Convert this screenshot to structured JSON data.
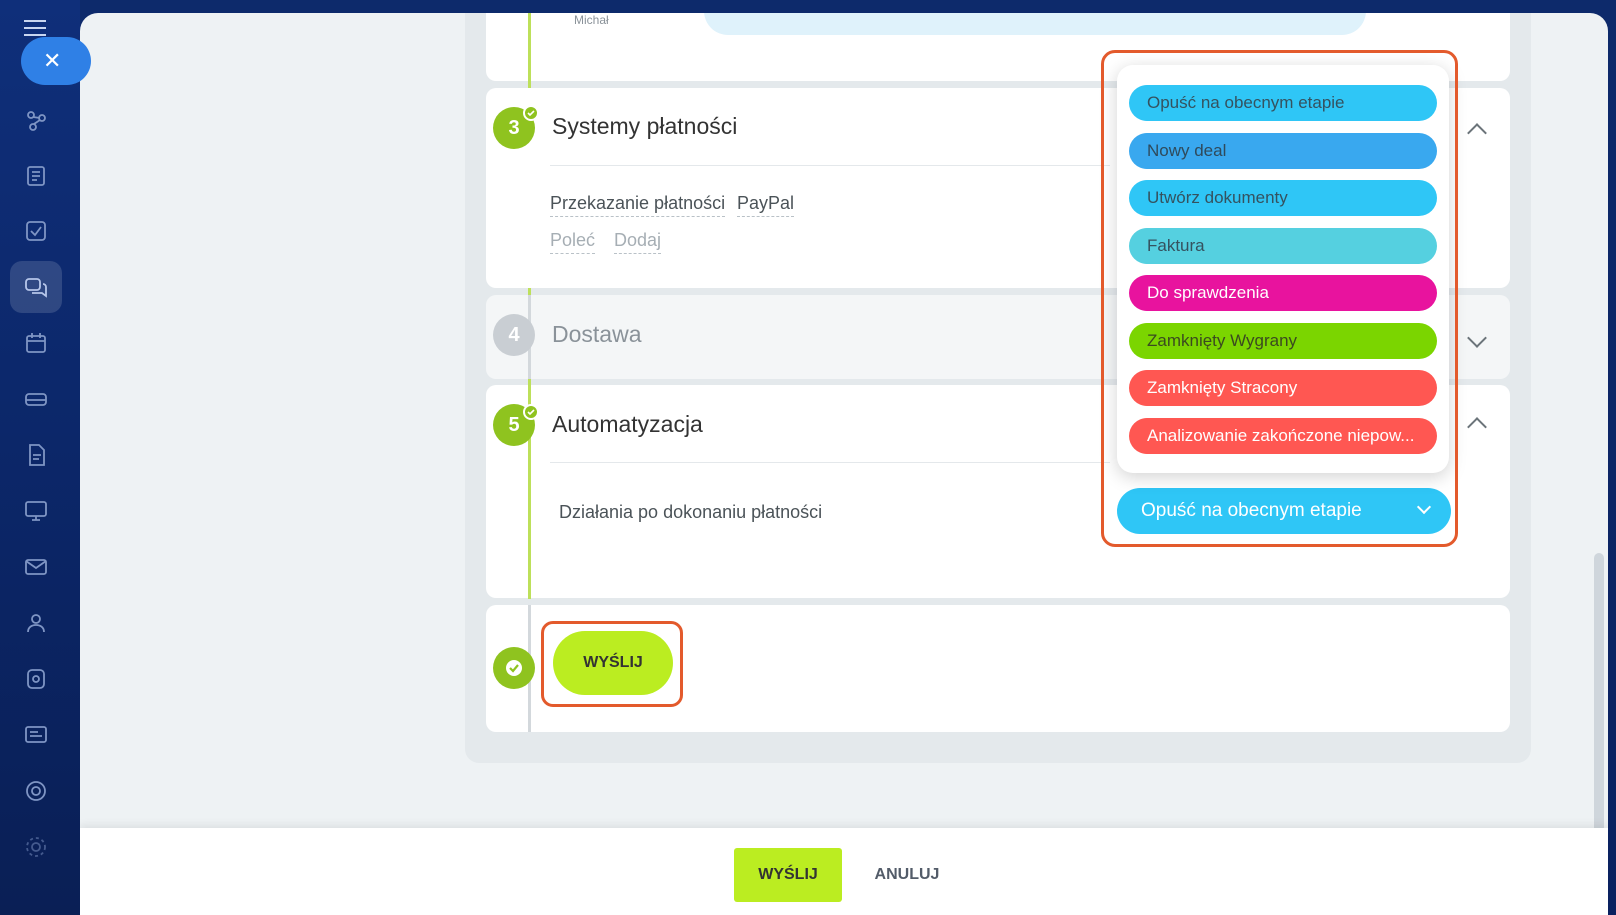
{
  "sidebar": {
    "close_icon": "close-icon",
    "icons": [
      "crm-icon",
      "feed-icon",
      "tasks-icon",
      "chat-icon",
      "calendar-icon",
      "drive-icon",
      "documents-icon",
      "sites-icon",
      "mail-icon",
      "contacts-icon",
      "automation-icon",
      "marketing-icon",
      "analytics-icon",
      "settings-icon"
    ]
  },
  "top_card": {
    "avatar_name": "Michał"
  },
  "steps": {
    "payment": {
      "number": "3",
      "title": "Systemy płatności",
      "transfer_link": "Przekazanie płatności",
      "paypal_link": "PayPal",
      "recommend_link": "Poleć",
      "add_link": "Dodaj"
    },
    "delivery": {
      "number": "4",
      "title": "Dostawa"
    },
    "automation": {
      "number": "5",
      "title": "Automatyzacja",
      "after_payment_label": "Działania po dokonaniu płatności",
      "selected_value": "Opuść na obecnym etapie"
    }
  },
  "dropdown": {
    "options": [
      {
        "label": "Opuść na obecnym etapie",
        "color": "#2fc6f6",
        "text_color": "#35525f"
      },
      {
        "label": "Nowy deal",
        "color": "#39a8ef",
        "text_color": "#2f4a5c"
      },
      {
        "label": "Utwórz dokumenty",
        "color": "#2fc6f6",
        "text_color": "#35525f"
      },
      {
        "label": "Faktura",
        "color": "#55d0e0",
        "text_color": "#35525f"
      },
      {
        "label": "Do sprawdzenia",
        "color": "#e8139e",
        "text_color": "#ffffff"
      },
      {
        "label": "Zamknięty Wygrany",
        "color": "#7bd500",
        "text_color": "#3b4a20"
      },
      {
        "label": "Zamknięty Stracony",
        "color": "#ff5752",
        "text_color": "#ffffff"
      },
      {
        "label": "Analizowanie zakończone niepow...",
        "color": "#ff5752",
        "text_color": "#ffffff"
      }
    ]
  },
  "inline_send_label": "WYŚLIJ",
  "footer": {
    "send_label": "WYŚLIJ",
    "cancel_label": "ANULUJ"
  },
  "colors": {
    "accent_green": "#bbed21",
    "step_green": "#8fc31f",
    "highlight": "#e35a2c"
  }
}
